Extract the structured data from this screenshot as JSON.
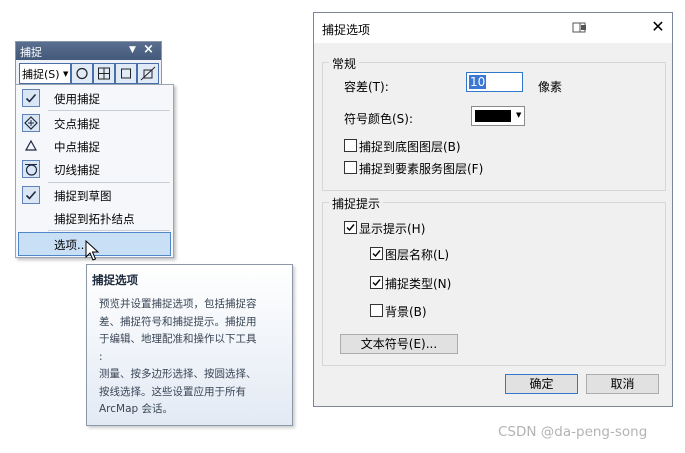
{
  "toolbar": {
    "title": "捕捉",
    "snap_menu_label": "捕捉(S)",
    "tools": [
      "point-snap-icon",
      "grid-snap-icon",
      "square-snap-icon",
      "edge-snap-icon"
    ]
  },
  "menu": {
    "items": [
      {
        "label": "使用捕捉",
        "icon": "check-icon",
        "checked": true
      },
      {
        "label": "交点捕捉",
        "icon": "intersection-snap-icon",
        "checked": true
      },
      {
        "label": "中点捕捉",
        "icon": "midpoint-snap-icon",
        "checked": false
      },
      {
        "label": "切线捕捉",
        "icon": "tangent-snap-icon",
        "checked": true
      },
      {
        "label": "捕捉到草图",
        "icon": "check-icon",
        "checked": true
      },
      {
        "label": "捕捉到拓扑结点",
        "icon": "",
        "checked": false
      },
      {
        "label": "选项...",
        "icon": "",
        "checked": false,
        "highlighted": true
      }
    ]
  },
  "tooltip": {
    "title": "捕捉选项",
    "body": "预览并设置捕捉选项，包括捕捉容\n差、捕捉符号和捕捉提示。捕捉用\n于编辑、地理配准和操作以下工具\n:\n测量、按多边形选择、按圆选择、\n按线选择。这些设置应用于所有\nArcMap 会话。"
  },
  "dialog": {
    "title": "捕捉选项",
    "general": {
      "label": "常规",
      "tolerance_label": "容差(T):",
      "tolerance_value": "10",
      "tolerance_unit": "像素",
      "symbol_color_label": "符号颜色(S):",
      "symbol_color": "#000000",
      "snap_basemap_label": "捕捉到底图图层(B)",
      "snap_basemap_checked": false,
      "snap_feature_service_label": "捕捉到要素服务图层(F)",
      "snap_feature_service_checked": false
    },
    "tips": {
      "label": "捕捉提示",
      "show_tips_label": "显示提示(H)",
      "show_tips_checked": true,
      "layer_name_label": "图层名称(L)",
      "layer_name_checked": true,
      "snap_type_label": "捕捉类型(N)",
      "snap_type_checked": true,
      "background_label": "背景(B)",
      "background_checked": false,
      "text_symbol_button": "文本符号(E)..."
    },
    "ok_label": "确定",
    "cancel_label": "取消"
  },
  "watermark": "CSDN @da-peng-song",
  "colors": {
    "accent": "#2f78cc",
    "menu_highlight": "#c9dff5",
    "dialog_bg": "#f0f0f0"
  }
}
